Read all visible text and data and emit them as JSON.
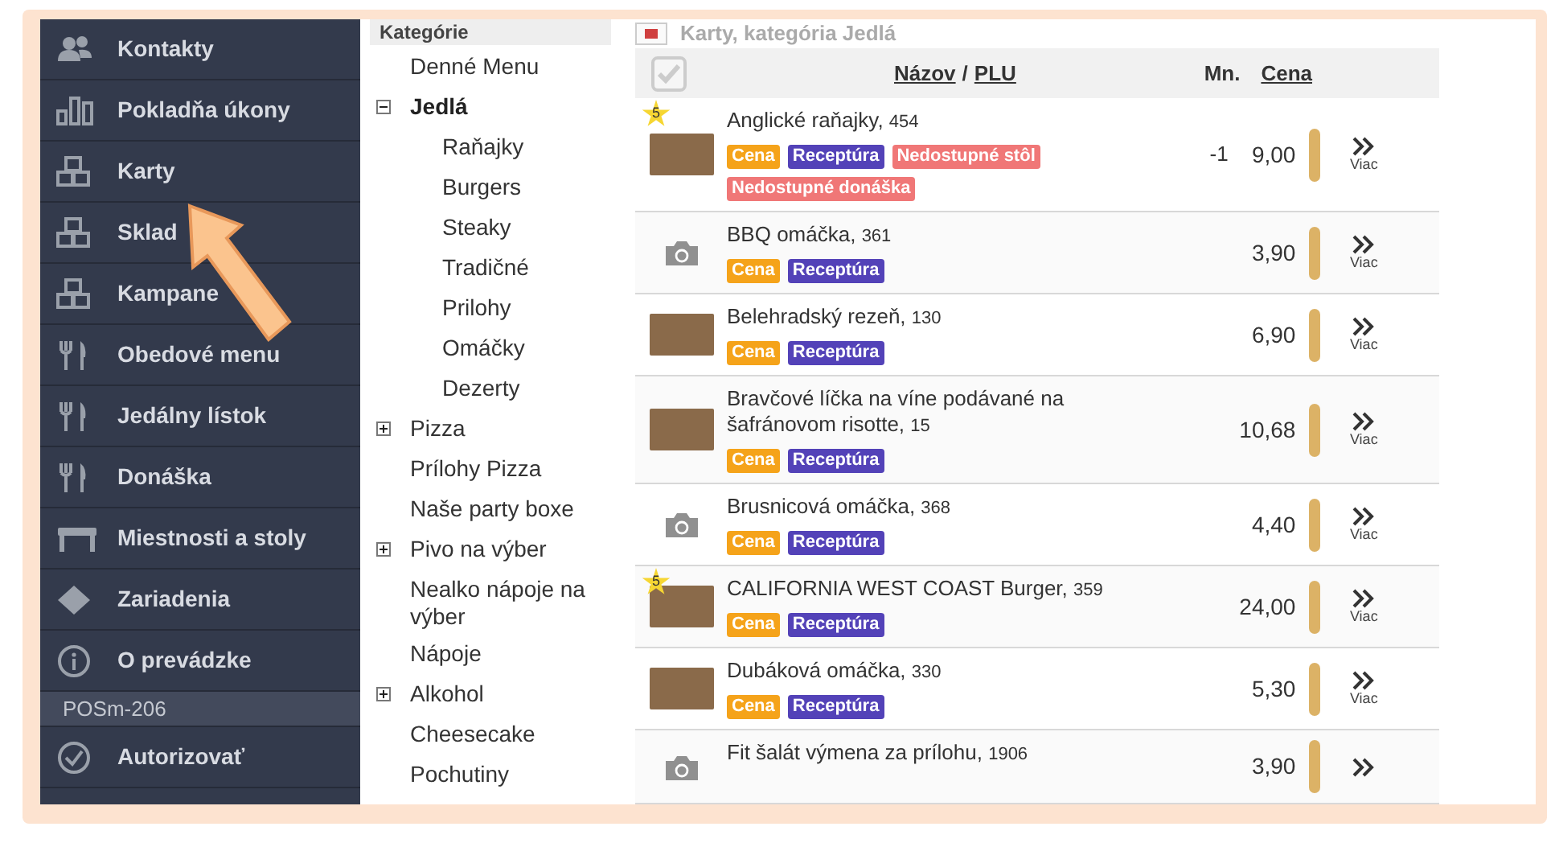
{
  "sidebar": {
    "items": [
      {
        "label": "Kontakty",
        "selected": false
      },
      {
        "label": "Pokladňa úkony",
        "selected": false
      },
      {
        "label": "Karty",
        "selected": false
      },
      {
        "label": "Sklad",
        "selected": false
      },
      {
        "label": "Kampane",
        "selected": false
      },
      {
        "label": "Obedové menu",
        "selected": false
      },
      {
        "label": "Jedálny lístok",
        "selected": false
      },
      {
        "label": "Donáška",
        "selected": false
      },
      {
        "label": "Miestnosti a stoly",
        "selected": false
      },
      {
        "label": "Zariadenia",
        "selected": false
      },
      {
        "label": "O prevádzke",
        "selected": false
      }
    ],
    "device": "POSm-206",
    "authorize": {
      "label": "Autorizovať"
    }
  },
  "categories": {
    "title": "Kategórie",
    "items": [
      {
        "label": "Denné Menu",
        "selected": false
      },
      {
        "label": "Jedlá",
        "selected": true,
        "expanded": true,
        "children": [
          {
            "label": "Raňajky",
            "selected": false
          },
          {
            "label": "Burgers",
            "selected": false
          },
          {
            "label": "Steaky",
            "selected": false
          },
          {
            "label": "Tradičné",
            "selected": false
          },
          {
            "label": "Prilohy",
            "selected": false
          },
          {
            "label": "Omáčky",
            "selected": false
          },
          {
            "label": "Dezerty",
            "selected": false
          }
        ]
      },
      {
        "label": "Pizza",
        "selected": false,
        "expanded": false
      },
      {
        "label": "Prílohy Pizza",
        "selected": false
      },
      {
        "label": "Naše party boxe",
        "selected": false
      },
      {
        "label": "Pivo na výber",
        "selected": false,
        "expanded": false
      },
      {
        "label": "Nealko nápoje na výber",
        "selected": false
      },
      {
        "label": "Nápoje",
        "selected": false
      },
      {
        "label": "Alkohol",
        "selected": false,
        "expanded": false
      },
      {
        "label": "Cheesecake",
        "selected": false
      },
      {
        "label": "Pochutiny",
        "selected": false
      }
    ]
  },
  "cards": {
    "title": "Karty, kategória Jedlá",
    "columns": {
      "name": "Názov",
      "separator": "/",
      "plu": "PLU",
      "qty": "Mn.",
      "price": "Cena"
    },
    "select_all": {
      "checked": false
    },
    "rows": [
      {
        "kind": "photo",
        "name": "Anglické raňajky,",
        "plu": "454",
        "featured": "5",
        "qty": "-1",
        "price": "9,00",
        "more": "Viac",
        "tags": [
          {
            "label": "Cena",
            "kind": "price"
          },
          {
            "label": "Receptúra",
            "kind": "recipe"
          },
          {
            "label": "Nedostupné stôl",
            "kind": "unavailable"
          },
          {
            "label": "Nedostupné donáška",
            "kind": "unavailable"
          }
        ]
      },
      {
        "kind": "no-photo",
        "name": "BBQ omáčka,",
        "plu": "361",
        "price": "3,90",
        "more": "Viac",
        "tags": [
          {
            "label": "Cena",
            "kind": "price"
          },
          {
            "label": "Receptúra",
            "kind": "recipe"
          }
        ]
      },
      {
        "kind": "photo",
        "name": "Belehradský rezeň,",
        "plu": "130",
        "price": "6,90",
        "more": "Viac",
        "tags": [
          {
            "label": "Cena",
            "kind": "price"
          },
          {
            "label": "Receptúra",
            "kind": "recipe"
          }
        ]
      },
      {
        "kind": "photo",
        "name": "Bravčové líčka na víne podávané na šafránovom risotte,",
        "plu": "15",
        "price": "10,68",
        "more": "Viac",
        "tags": [
          {
            "label": "Cena",
            "kind": "price"
          },
          {
            "label": "Receptúra",
            "kind": "recipe"
          }
        ]
      },
      {
        "kind": "no-photo",
        "name": "Brusnicová omáčka,",
        "plu": "368",
        "price": "4,40",
        "more": "Viac",
        "tags": [
          {
            "label": "Cena",
            "kind": "price"
          },
          {
            "label": "Receptúra",
            "kind": "recipe"
          }
        ]
      },
      {
        "kind": "photo",
        "name": "CALIFORNIA WEST COAST Burger,",
        "plu": "359",
        "featured": "5",
        "price": "24,00",
        "more": "Viac",
        "tags": [
          {
            "label": "Cena",
            "kind": "price"
          },
          {
            "label": "Receptúra",
            "kind": "recipe"
          }
        ]
      },
      {
        "kind": "photo",
        "name": "Dubáková omáčka,",
        "plu": "330",
        "price": "5,30",
        "more": "Viac",
        "tags": [
          {
            "label": "Cena",
            "kind": "price"
          },
          {
            "label": "Receptúra",
            "kind": "recipe"
          }
        ]
      },
      {
        "kind": "no-photo",
        "name": "Fit šalát výmena za prílohu,",
        "plu": "1906",
        "price": "3,90"
      }
    ]
  }
}
